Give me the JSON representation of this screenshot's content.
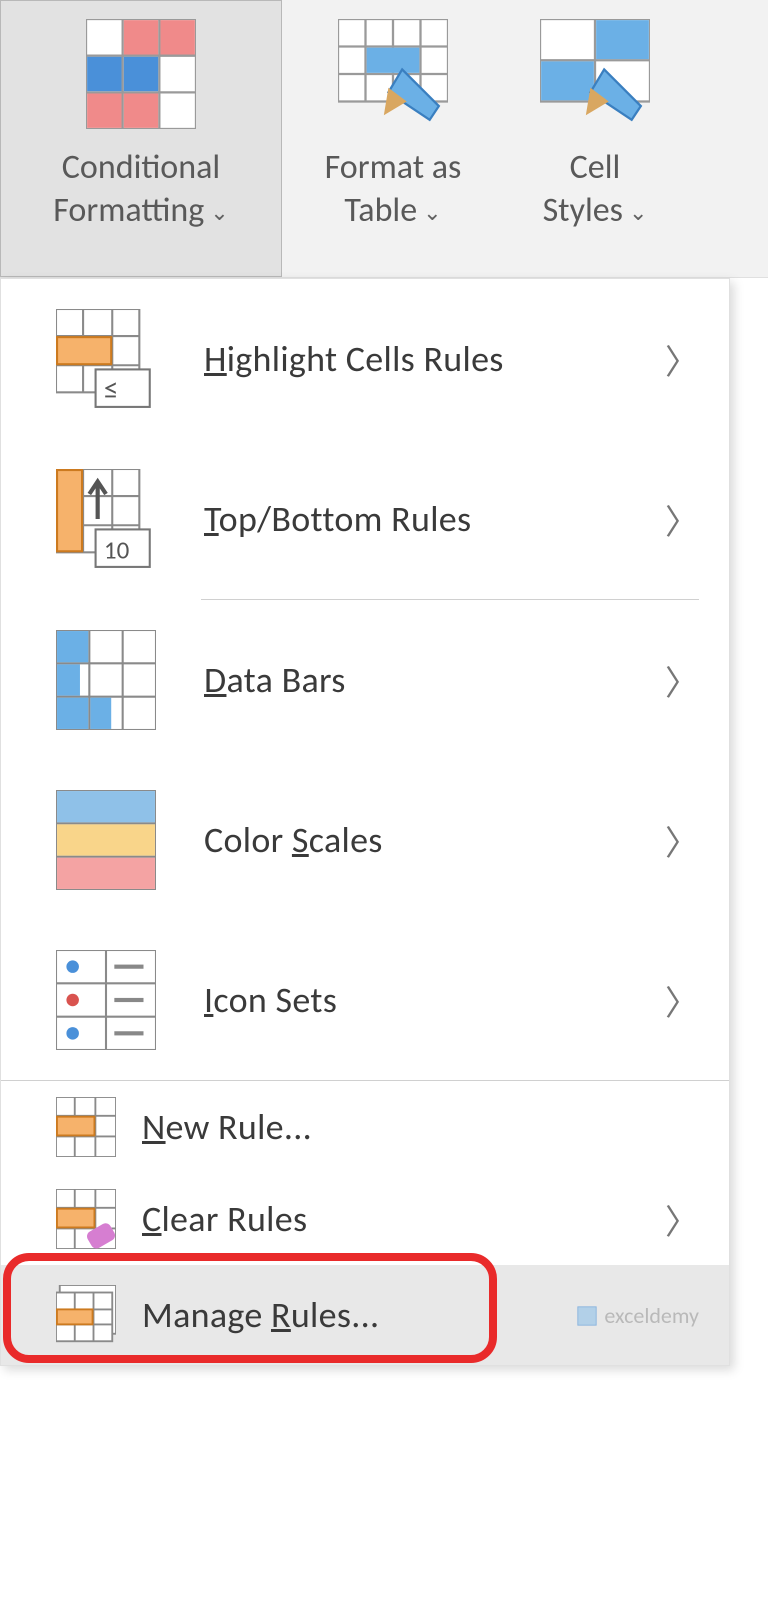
{
  "ribbon": {
    "conditional": {
      "line1": "Conditional",
      "line2": "Formatting"
    },
    "format_table": {
      "line1": "Format as",
      "line2": "Table"
    },
    "cell_styles": {
      "line1": "Cell",
      "line2": "Styles"
    }
  },
  "menu": {
    "highlight": {
      "pre": "",
      "u": "H",
      "post": "ighlight Cells Rules"
    },
    "topbottom": {
      "pre": "",
      "u": "T",
      "post": "op/Bottom Rules"
    },
    "databars": {
      "pre": "",
      "u": "D",
      "post": "ata Bars"
    },
    "colorscales": {
      "pre": "Color ",
      "u": "S",
      "post": "cales"
    },
    "iconsets": {
      "pre": "",
      "u": "I",
      "post": "con Sets"
    },
    "newrule": {
      "pre": "",
      "u": "N",
      "post": "ew Rule..."
    },
    "clearrules": {
      "pre": "",
      "u": "C",
      "post": "lear Rules"
    },
    "managerules": {
      "pre": "Manage ",
      "u": "R",
      "post": "ules..."
    }
  },
  "watermark": "exceldemy"
}
